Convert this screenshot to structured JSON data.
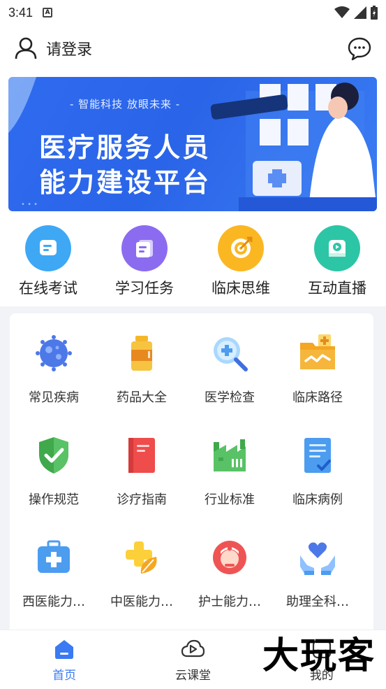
{
  "status_bar": {
    "time": "3:41",
    "notif_icon": "A"
  },
  "header": {
    "login_label": "请登录"
  },
  "banner": {
    "slogan": "- 智能科技 放眼未来 -",
    "title_line1": "医疗服务人员",
    "title_line2": "能力建设平台"
  },
  "quick_actions": [
    {
      "label": "在线考试",
      "icon": "exam-icon",
      "color": "#3ea8f5"
    },
    {
      "label": "学习任务",
      "icon": "task-icon",
      "color": "#8b6cf0"
    },
    {
      "label": "临床思维",
      "icon": "target-icon",
      "color": "#fbb722"
    },
    {
      "label": "互动直播",
      "icon": "live-icon",
      "color": "#2cc6a6"
    }
  ],
  "grid_items": [
    {
      "label": "常见疾病",
      "icon": "virus-icon"
    },
    {
      "label": "药品大全",
      "icon": "medicine-bottle-icon"
    },
    {
      "label": "医学检查",
      "icon": "magnifier-icon"
    },
    {
      "label": "临床路径",
      "icon": "folder-path-icon"
    },
    {
      "label": "操作规范",
      "icon": "shield-check-icon"
    },
    {
      "label": "诊疗指南",
      "icon": "guide-book-icon"
    },
    {
      "label": "行业标准",
      "icon": "factory-icon"
    },
    {
      "label": "临床病例",
      "icon": "case-document-icon"
    },
    {
      "label": "西医能力…",
      "icon": "medical-kit-icon"
    },
    {
      "label": "中医能力…",
      "icon": "herbal-icon"
    },
    {
      "label": "护士能力…",
      "icon": "nurse-icon"
    },
    {
      "label": "助理全科…",
      "icon": "care-hands-icon"
    }
  ],
  "bottom_nav": [
    {
      "label": "首页",
      "icon": "home-icon",
      "active": true
    },
    {
      "label": "云课堂",
      "icon": "cloud-play-icon",
      "active": false
    },
    {
      "label": "我的",
      "icon": "profile-icon",
      "active": false
    }
  ],
  "watermark": "大玩客",
  "colors": {
    "accent": "#3a7af2",
    "banner_bg": "#2f6bf0"
  }
}
